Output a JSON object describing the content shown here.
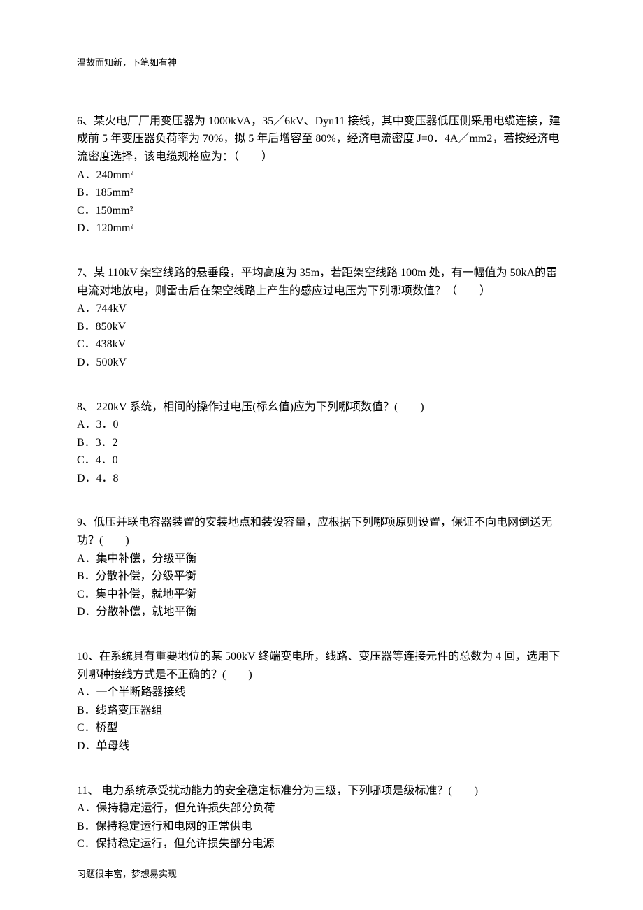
{
  "header_note": "温故而知新，下笔如有神",
  "footer_note": "习题很丰富，梦想易实现",
  "questions": [
    {
      "number": "6、",
      "text": "某火电厂厂用变压器为 1000kVA，35／6kV、Dyn11 接线，其中变压器低压侧采用电缆连接，建成前 5 年变压器负荷率为 70%，拟 5 年后增容至 80%，经济电流密度 J=0．4A／mm2，若按经济电流密度选择，该电缆规格应为：（　　）",
      "options": [
        "A．240mm²",
        "B．185mm²",
        "C．150mm²",
        "D．120mm²"
      ]
    },
    {
      "number": "7、",
      "text": "某 110kV 架空线路的悬垂段，平均高度为 35m，若距架空线路 100m 处，有一幅值为 50kA的雷电流对地放电，则雷击后在架空线路上产生的感应过电压为下列哪项数值？（　　）",
      "options": [
        "A．744kV",
        "B．850kV",
        "C．438kV",
        "D．500kV"
      ]
    },
    {
      "number": "8、",
      "text": " 220kV 系统，相间的操作过电压(标幺值)应为下列哪项数值？(　　)",
      "options": [
        "A．3．0",
        "B．3．2",
        "C．4．0",
        "D．4．8"
      ]
    },
    {
      "number": "9、",
      "text": "低压并联电容器装置的安装地点和装设容量，应根据下列哪项原则设置，保证不向电网倒送无功？(　　)",
      "options": [
        "A．集中补偿，分级平衡",
        "B．分散补偿，分级平衡",
        "C．集中补偿，就地平衡",
        "D．分散补偿，就地平衡"
      ]
    },
    {
      "number": "10、",
      "text": "在系统具有重要地位的某 500kV 终端变电所，线路、变压器等连接元件的总数为 4 回，选用下列哪种接线方式是不正确的？(　　)",
      "options": [
        "A．一个半断路器接线",
        "B．线路变压器组",
        "C．桥型",
        "D．单母线"
      ]
    },
    {
      "number": "11、",
      "text": " 电力系统承受扰动能力的安全稳定标准分为三级，下列哪项是级标准？(　　)",
      "options": [
        "A．保持稳定运行，但允许损失部分负荷",
        "B．保持稳定运行和电网的正常供电",
        "C．保持稳定运行，但允许损失部分电源"
      ]
    }
  ]
}
